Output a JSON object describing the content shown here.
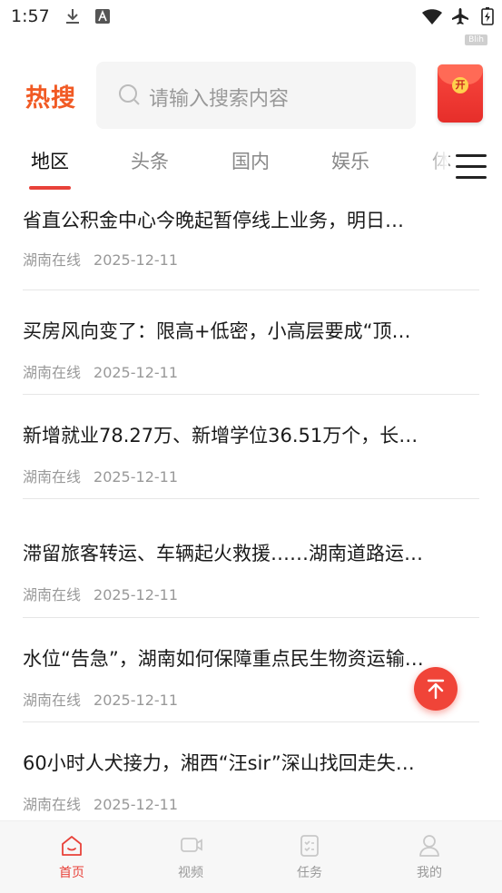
{
  "status_bar": {
    "time": "1:57",
    "badge": "Blih"
  },
  "header": {
    "logo": "热搜",
    "search_placeholder": "请输入搜索内容"
  },
  "tabs": [
    {
      "label": "地区",
      "active": true
    },
    {
      "label": "头条",
      "active": false
    },
    {
      "label": "国内",
      "active": false
    },
    {
      "label": "娱乐",
      "active": false
    },
    {
      "label": "体",
      "active": false
    }
  ],
  "news": [
    {
      "title": "省直公积金中心今晚起暂停线上业务，明日…",
      "source": "湖南在线",
      "date": "2025-12-11"
    },
    {
      "title": "买房风向变了：限高+低密，小高层要成“顶…",
      "source": "湖南在线",
      "date": "2025-12-11"
    },
    {
      "title": "新增就业78.27万、新增学位36.51万个，长…",
      "source": "湖南在线",
      "date": "2025-12-11"
    },
    {
      "title": "滞留旅客转运、车辆起火救援……湖南道路运…",
      "source": "湖南在线",
      "date": "2025-12-11"
    },
    {
      "title": "水位“告急”，湖南如何保障重点民生物资运输…",
      "source": "湖南在线",
      "date": "2025-12-11"
    },
    {
      "title": "60小时人犬接力，湘西“汪sir”深山找回走失…",
      "source": "湖南在线",
      "date": "2025-12-11"
    }
  ],
  "bottom_nav": [
    {
      "label": "首页",
      "icon": "home-icon",
      "active": true
    },
    {
      "label": "视频",
      "icon": "video-icon",
      "active": false
    },
    {
      "label": "任务",
      "icon": "task-icon",
      "active": false
    },
    {
      "label": "我的",
      "icon": "profile-icon",
      "active": false
    }
  ],
  "colors": {
    "accent": "#e8423a",
    "logo": "#f15a24"
  }
}
